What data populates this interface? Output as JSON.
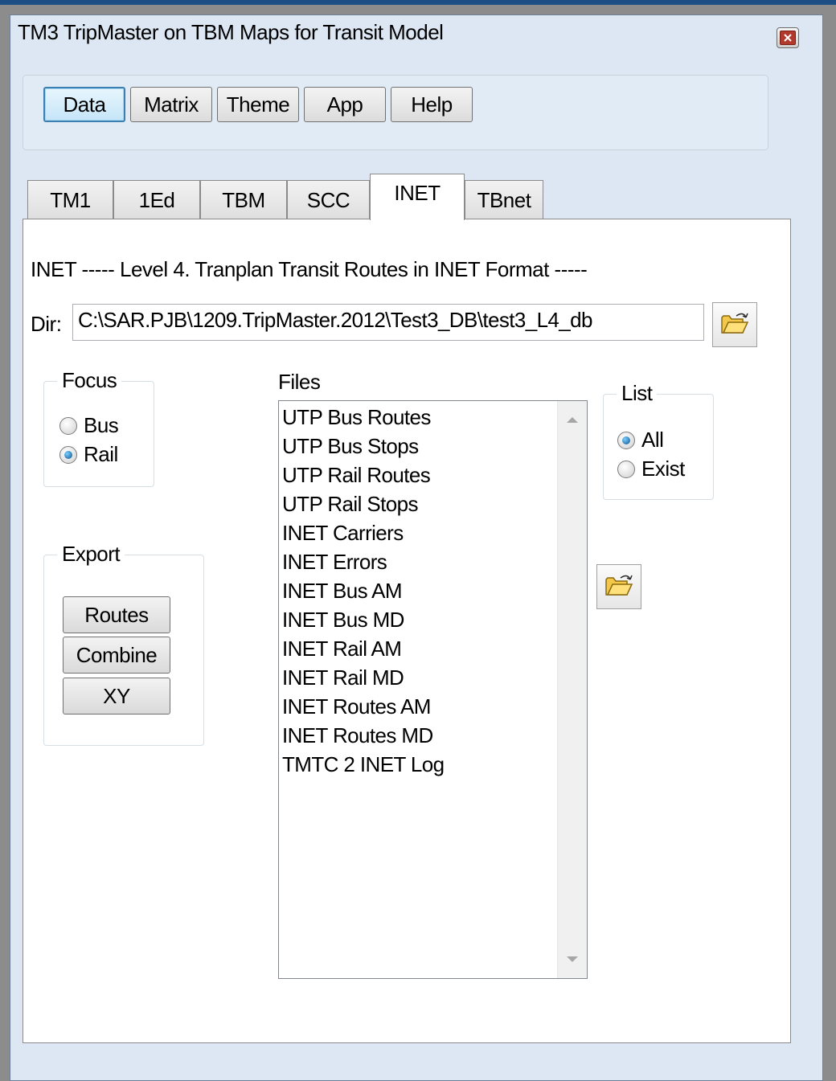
{
  "window": {
    "title": "TM3 TripMaster on TBM Maps for Transit Model"
  },
  "toolbar": {
    "buttons": [
      "Data",
      "Matrix",
      "Theme",
      "App",
      "Help"
    ]
  },
  "tabs": [
    "TM1",
    "1Ed",
    "TBM",
    "SCC",
    "INET",
    "TBnet"
  ],
  "panel": {
    "heading": "INET ----- Level 4. Tranplan Transit Routes in INET Format -----",
    "dir_label": "Dir:",
    "dir_value": "C:\\SAR.PJB\\1209.TripMaster.2012\\Test3_DB\\test3_L4_db",
    "focus": {
      "title": "Focus",
      "options": [
        "Bus",
        "Rail"
      ],
      "selected": "Rail"
    },
    "export": {
      "title": "Export",
      "buttons": [
        "Routes",
        "Combine",
        "XY"
      ]
    },
    "files": {
      "title": "Files",
      "items": [
        "UTP Bus Routes",
        "UTP Bus Stops",
        "UTP Rail Routes",
        "UTP Rail Stops",
        "INET Carriers",
        "INET Errors",
        "INET Bus AM",
        "INET Bus MD",
        "INET Rail AM",
        "INET Rail MD",
        "INET Routes AM",
        "INET Routes MD",
        "TMTC 2 INET Log"
      ]
    },
    "list": {
      "title": "List",
      "options": [
        "All",
        "Exist"
      ],
      "selected": "All"
    }
  },
  "icons": {
    "close": "close-icon",
    "folder": "open-folder-icon"
  }
}
